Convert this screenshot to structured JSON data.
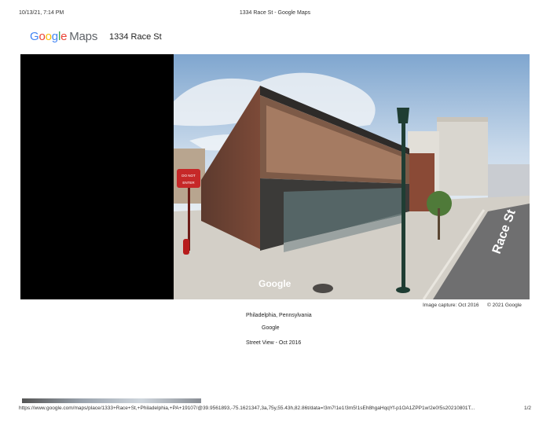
{
  "header": {
    "datetime": "10/13/21, 7:14 PM",
    "title": "1334 Race St - Google Maps"
  },
  "logo": {
    "brand": "Google",
    "product": "Maps"
  },
  "place_title": "1334 Race St",
  "viewer": {
    "watermark": "Google",
    "street_label": "Race St",
    "sign_text_top": "DO NOT",
    "sign_text_bottom": "ENTER",
    "image_capture": "Image capture: Oct 2016",
    "copyright": "© 2021 Google"
  },
  "info": {
    "location": "Philadelphia, Pennsylvania",
    "provider": "Google",
    "street_view": "Street View - Oct 2016"
  },
  "footer": {
    "url": "https://www.google.com/maps/place/1333+Race+St,+Philadelphia,+PA+19107/@39.9561893,-75.1621347,3a,75y,55.43h,82.86t/data=!3m7!1e1!3m5!1sEh8hgaHqqYf-p1OA1ZPP1w!2e0!5s20210801T...",
    "page": "1/2"
  },
  "colors": {
    "viewer_bg": "#000000",
    "sky": "#a9c4e0",
    "brick": "#8a4a36"
  }
}
